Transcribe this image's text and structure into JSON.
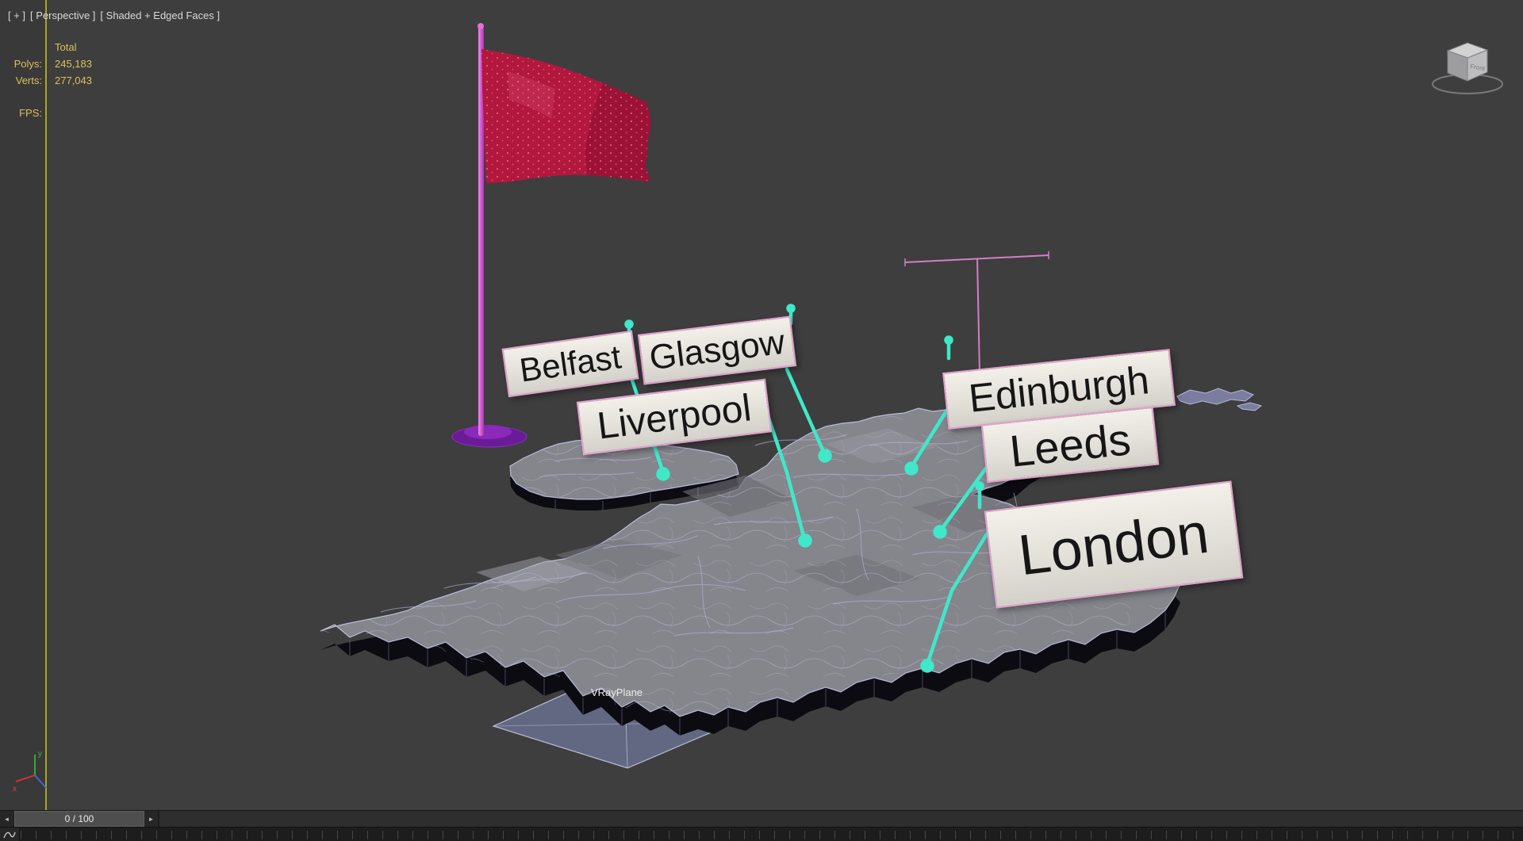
{
  "viewport": {
    "menus": {
      "general": "[ + ]",
      "pov": "[ Perspective ]",
      "shading": "[ Shaded + Edged Faces ]"
    },
    "stats": {
      "total": "Total",
      "polys_label": "Polys:",
      "polys_value": "245,183",
      "verts_label": "Verts:",
      "verts_value": "277,043",
      "fps_label": "FPS:"
    }
  },
  "scene": {
    "cities": [
      {
        "name": "Belfast"
      },
      {
        "name": "Glasgow"
      },
      {
        "name": "Liverpool"
      },
      {
        "name": "Edinburgh"
      },
      {
        "name": "Leeds"
      },
      {
        "name": "London"
      }
    ],
    "plane_label": "VRayPlane",
    "viewcube": {
      "face_label": "Front"
    },
    "axis": {
      "x": "x",
      "y": "y"
    },
    "colors": {
      "connector": "#3fe8c9",
      "label_border": "#e2a3ce",
      "flag": "#b2173e",
      "pole": "#d95fd9",
      "map_top": "#85858c",
      "wireframe": "#bcbce2",
      "stats_text": "#d9c25a",
      "viewport_border": "#aaa41e"
    }
  },
  "timeline": {
    "prev": "◄",
    "next": "►",
    "frame_display": "0 / 100"
  }
}
